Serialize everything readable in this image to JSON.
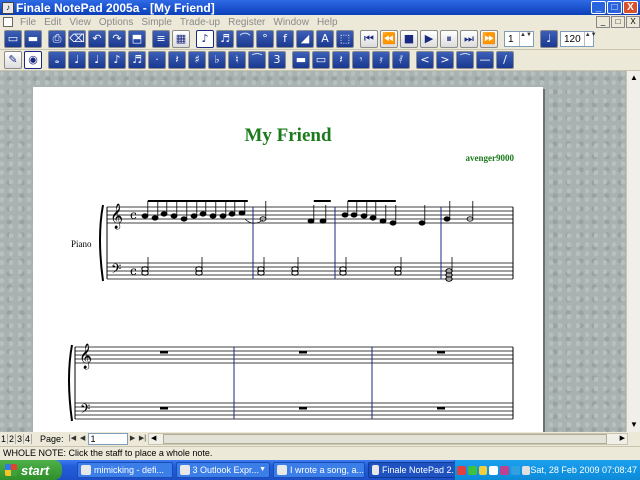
{
  "window": {
    "title": "Finale NotePad 2005a - [My Friend]",
    "minimize": "_",
    "maximize": "□",
    "close": "X"
  },
  "menu": {
    "items": [
      "File",
      "Edit",
      "View",
      "Options",
      "Simple",
      "Trade-up",
      "Register",
      "Window",
      "Help"
    ],
    "mdi": [
      "_",
      "□",
      "X"
    ]
  },
  "toolbar1": {
    "buttons": [
      {
        "name": "new-document",
        "glyph": "▭"
      },
      {
        "name": "open-folder",
        "glyph": "▬"
      },
      {
        "name": "print",
        "glyph": "⎙"
      },
      {
        "name": "erase",
        "glyph": "⌫"
      },
      {
        "name": "undo",
        "glyph": "↶"
      },
      {
        "name": "redo",
        "glyph": "↷"
      },
      {
        "name": "save",
        "glyph": "⬒"
      },
      {
        "name": "staff-tool",
        "glyph": "≡"
      },
      {
        "name": "measure-tool",
        "glyph": "▦"
      },
      {
        "name": "simple-entry",
        "glyph": "♪"
      },
      {
        "name": "speedy-entry",
        "glyph": "♬"
      },
      {
        "name": "smart-shape",
        "glyph": "⌒"
      },
      {
        "name": "articulation",
        "glyph": "°"
      },
      {
        "name": "expression",
        "glyph": "f"
      },
      {
        "name": "lyrics",
        "glyph": "◢"
      },
      {
        "name": "text-tool",
        "glyph": "A"
      },
      {
        "name": "selection-tool",
        "glyph": "⬚"
      }
    ],
    "playback": [
      "⏮",
      "⏪",
      "■",
      "▶",
      "⏸",
      "⏭",
      "⏩"
    ],
    "measure_value": "1",
    "tempo_value": "120"
  },
  "toolbar2": {
    "buttons": [
      {
        "name": "eraser-note",
        "glyph": "✎"
      },
      {
        "name": "selection-note",
        "glyph": "◉"
      },
      {
        "name": "whole-note",
        "glyph": "𝅝"
      },
      {
        "name": "half-note",
        "glyph": "♩"
      },
      {
        "name": "quarter-note",
        "glyph": "♩"
      },
      {
        "name": "eighth-note",
        "glyph": "♪"
      },
      {
        "name": "sixteenth-note",
        "glyph": "♬"
      },
      {
        "name": "dot",
        "glyph": "·"
      },
      {
        "name": "rest",
        "glyph": "𝄽"
      },
      {
        "name": "sharp",
        "glyph": "♯"
      },
      {
        "name": "flat",
        "glyph": "♭"
      },
      {
        "name": "natural",
        "glyph": "♮"
      },
      {
        "name": "tie",
        "glyph": "⁀"
      },
      {
        "name": "tuplet",
        "glyph": "3"
      },
      {
        "name": "rest-whole",
        "glyph": "▬"
      },
      {
        "name": "rest-half",
        "glyph": "▭"
      },
      {
        "name": "rest-quarter",
        "glyph": "𝄽"
      },
      {
        "name": "rest-eighth",
        "glyph": "𝄾"
      },
      {
        "name": "rest-sixteenth",
        "glyph": "𝄿"
      },
      {
        "name": "rest-32nd",
        "glyph": "𝅀"
      },
      {
        "name": "crescendo",
        "glyph": "<"
      },
      {
        "name": "diminuendo",
        "glyph": ">"
      },
      {
        "name": "slur",
        "glyph": "⁀"
      },
      {
        "name": "accent-line",
        "glyph": "—"
      },
      {
        "name": "pen-line",
        "glyph": "/"
      }
    ]
  },
  "score": {
    "title": "My Friend",
    "composer": "avenger9000",
    "instrument": "Piano"
  },
  "nav": {
    "page_tabs": [
      "1",
      "2",
      "3",
      "4"
    ],
    "page_label": "Page:",
    "page_value": "1"
  },
  "status": {
    "text": "WHOLE NOTE: Click the staff to place a whole note."
  },
  "taskbar": {
    "start": "start",
    "tasks": [
      {
        "label": "mimicking - defi...",
        "active": false
      },
      {
        "label": "3 Outlook Expr...",
        "active": false,
        "dropdown": true
      },
      {
        "label": "I wrote a song, a...",
        "active": false
      },
      {
        "label": "Finale NotePad 2...",
        "active": true
      }
    ],
    "clock": "Sat, 28 Feb 2009 07:08:47"
  },
  "colors": {
    "title_green": "#1b7a1b",
    "titlebar_blue": "#0a3fb8",
    "taskbar_blue": "#245edb",
    "start_green": "#3a9a35"
  }
}
